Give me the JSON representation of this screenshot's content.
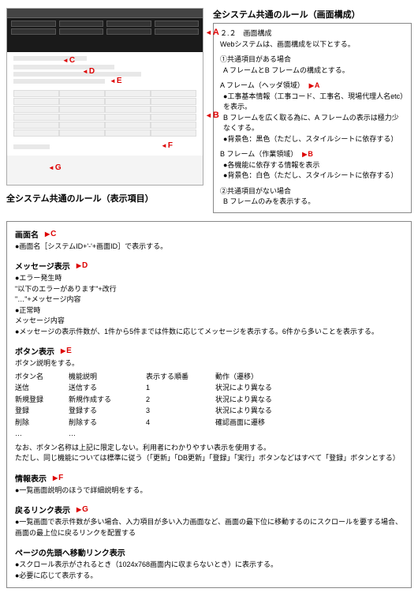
{
  "topRight": {
    "mainTitle": "全システム共通のルール（画面構成）",
    "num": "２.２　画面構成",
    "intro": "Webシステムは、画面構成を以下とする。",
    "case1": "①共通項目がある場合",
    "case1sub": "A フレームとB フレームの構成とする。",
    "aframe": "A フレーム（ヘッダ領域）",
    "aframe1": "●工事基本情報（工事コード、工事名、現場代理人名etc）を表示。",
    "aframe2": "B フレームを広く取る為に、A フレームの表示は極力少なくする。",
    "aframe3": "●背景色：黒色（ただし、スタイルシートに依存する）",
    "bframe": "B フレーム（作業領域）",
    "bframe1": "●各機能に依存する情報を表示",
    "bframe2": "●背景色：白色（ただし、スタイルシートに依存する）",
    "case2": "②共通項目がない場合",
    "case2sub": "B フレームのみを表示する。",
    "labelA": "A",
    "labelB": "B"
  },
  "labels": {
    "A": "A",
    "B": "B",
    "C": "C",
    "D": "D",
    "E": "E",
    "F": "F",
    "G": "G"
  },
  "lowerTitle": "全システム共通のルール（表示項目）",
  "C": {
    "title": "画面名",
    "body": "●画面名［システムID+'-'+画面ID］で表示する。"
  },
  "D": {
    "title": "メッセージ表示",
    "l1": "●エラー発生時",
    "l2": "\"以下のエラーがあります\"+改行",
    "l3": "\"…\"+メッセージ内容",
    "l4": "●正常時",
    "l5": "メッセージ内容",
    "l6": "●メッセージの表示件数が、1件から5件までは件数に応じてメッセージを表示する。6件から多いことを表示する。"
  },
  "E": {
    "title": "ボタン表示",
    "sub": "ボタン説明をする。",
    "h1": "ボタン名",
    "h2": "機能説明",
    "h3": "表示する順番",
    "h4": "動作（遷移）",
    "r": [
      [
        "送信",
        "送信する",
        "1",
        "状況により異なる"
      ],
      [
        "新規登録",
        "新規作成する",
        "2",
        "状況により異なる"
      ],
      [
        "登録",
        "登録する",
        "3",
        "状況により異なる"
      ],
      [
        "削除",
        "削除する",
        "4",
        "確認画面に遷移"
      ]
    ],
    "dots": "…",
    "dots2": "…",
    "note1": "なお、ボタン名称は上記に限定しない。利用者にわかりやすい表示を使用する。",
    "note2": "ただし、同じ機能については標準に従う（「更新」「DB更新」「登録」「実行」ボタンなどはすべて「登録」ボタンとする）"
  },
  "F": {
    "title": "情報表示",
    "body": "●一覧画面説明のほうで詳細説明をする。"
  },
  "G": {
    "title": "戻るリンク表示",
    "body": "●一覧画面で表示件数が多い場合、入力項目が多い入力画面など、画面の最下位に移動するのにスクロールを要する場合、画面の最上位に戻るリンクを配置する"
  },
  "P": {
    "title": "ページの先頭へ移動リンク表示",
    "l1": "●スクロール表示がされるとき（1024x768画面内に収まらないとき）に表示する。",
    "l2": "●必要に応じて表示する。"
  }
}
